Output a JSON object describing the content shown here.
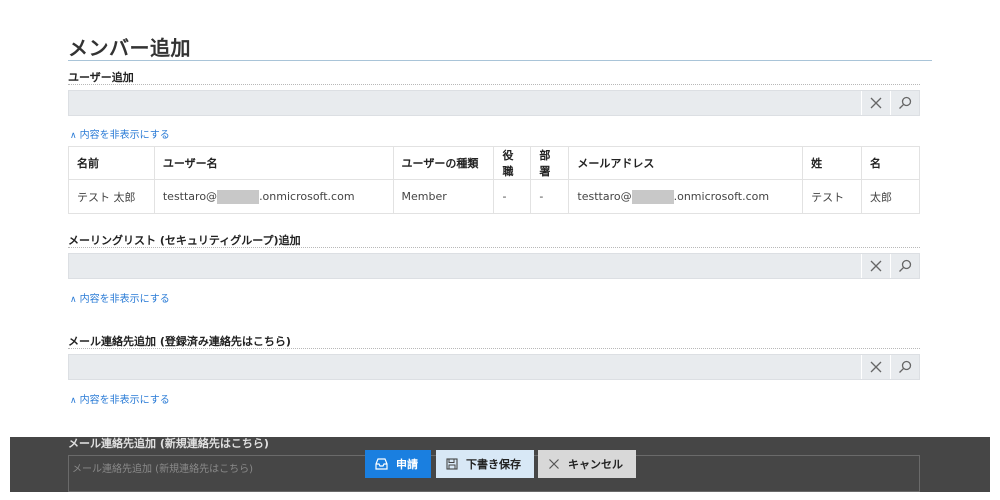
{
  "page": {
    "title": "メンバー追加"
  },
  "icons": {
    "clear": "close-icon",
    "search": "search-icon",
    "apply": "inbox-icon",
    "draft": "floppy-disk-icon",
    "cancel": "close-icon"
  },
  "sections": {
    "users": {
      "label": "ユーザー追加",
      "toggle": "内容を非表示にする"
    },
    "groups": {
      "label": "メーリングリスト (セキュリティグループ)追加",
      "toggle": "内容を非表示にする"
    },
    "contacts_registered": {
      "label": "メール連絡先追加 (登録済み連絡先はこちら)",
      "toggle": "内容を非表示にする"
    },
    "contacts_new": {
      "label": "メール連絡先追加 (新規連絡先はこちら)",
      "placeholder": "メール連絡先追加 (新規連絡先はこちら)"
    }
  },
  "member_table": {
    "headers": [
      "名前",
      "ユーザー名",
      "ユーザーの種類",
      "役職",
      "部署",
      "メールアドレス",
      "姓",
      "名"
    ],
    "rows": [
      {
        "name": "テスト 太郎",
        "username_prefix": "testtaro@",
        "username_suffix": ".onmicrosoft.com",
        "user_type": "Member",
        "title": "-",
        "department": "-",
        "email_prefix": "testtaro@",
        "email_suffix": ".onmicrosoft.com",
        "last_name": "テスト",
        "first_name": "太郎"
      }
    ]
  },
  "actions": {
    "apply": "申請",
    "draft": "下書き保存",
    "cancel": "キャンセル"
  },
  "colors": {
    "primary": "#1a7fe0",
    "link": "#2a7bd6",
    "overlay": "#282828"
  }
}
